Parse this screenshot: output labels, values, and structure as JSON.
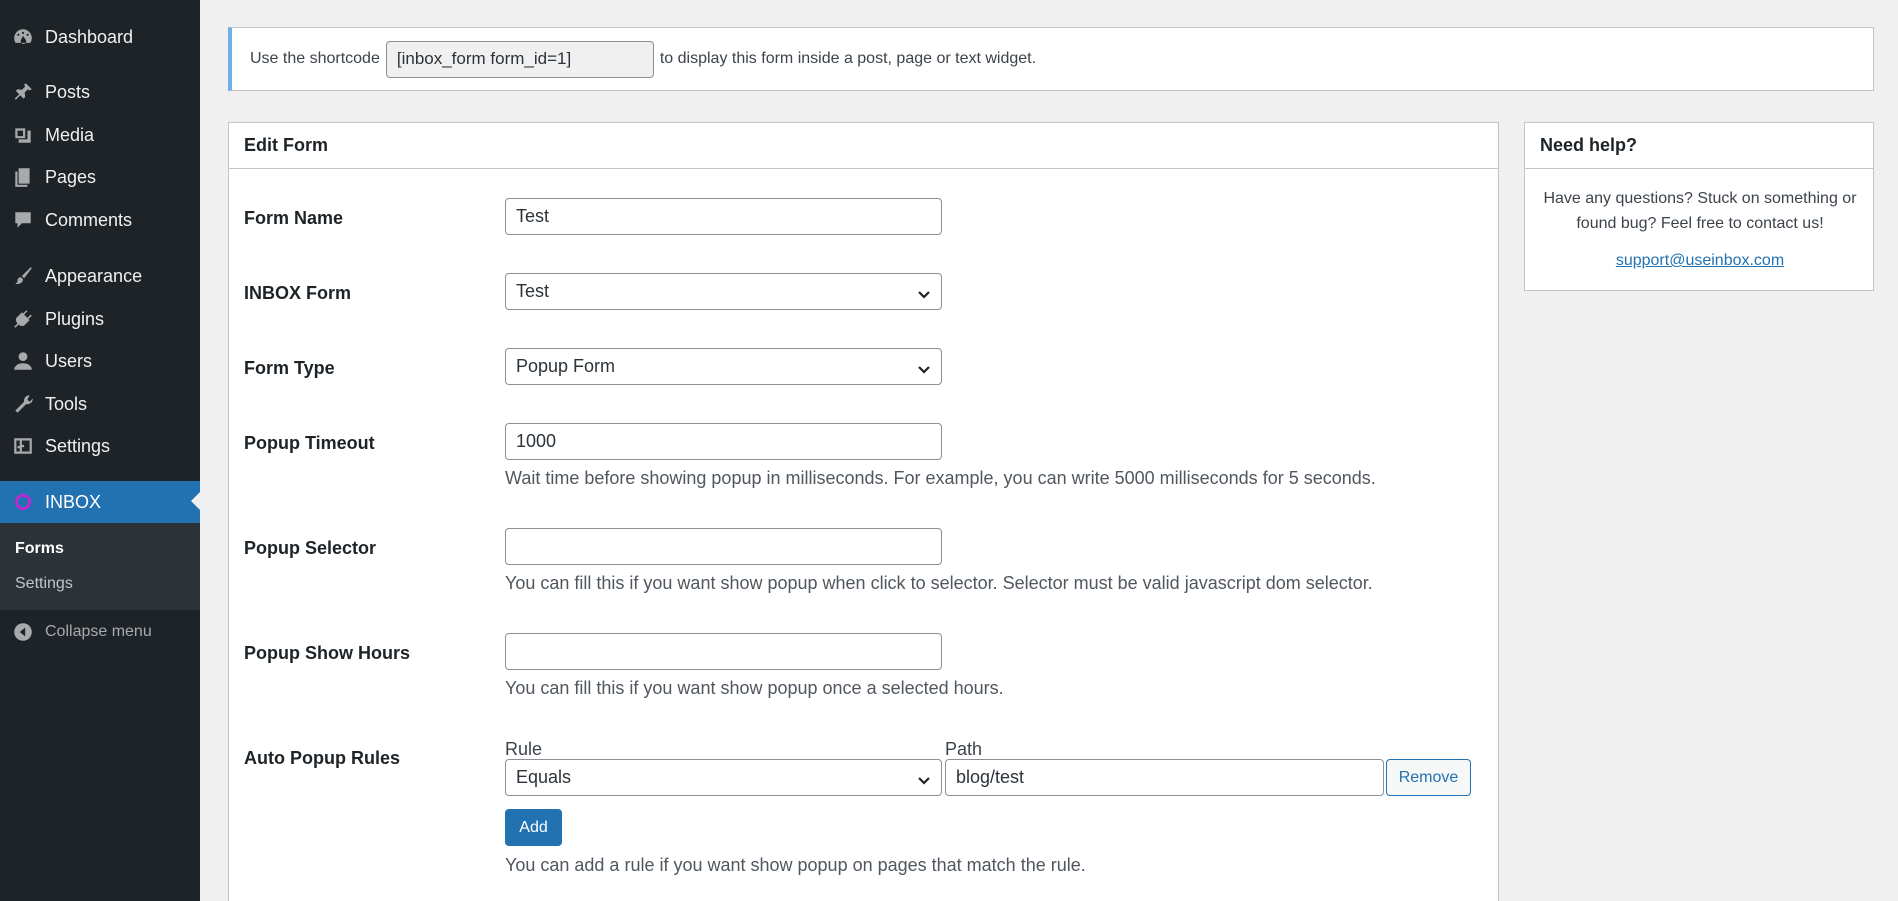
{
  "sidebar": {
    "items": [
      {
        "label": "Dashboard",
        "icon": "dashboard-icon"
      },
      {
        "label": "Posts",
        "icon": "pin-icon"
      },
      {
        "label": "Media",
        "icon": "media-icon"
      },
      {
        "label": "Pages",
        "icon": "pages-icon"
      },
      {
        "label": "Comments",
        "icon": "comment-icon"
      },
      {
        "label": "Appearance",
        "icon": "brush-icon"
      },
      {
        "label": "Plugins",
        "icon": "plugin-icon"
      },
      {
        "label": "Users",
        "icon": "user-icon"
      },
      {
        "label": "Tools",
        "icon": "wrench-icon"
      },
      {
        "label": "Settings",
        "icon": "settings-icon"
      },
      {
        "label": "INBOX",
        "icon": "inbox-logo-icon"
      }
    ],
    "submenu": [
      {
        "label": "Forms"
      },
      {
        "label": "Settings"
      }
    ],
    "collapse_label": "Collapse menu"
  },
  "notice": {
    "text_before": "Use the shortcode",
    "shortcode": "[inbox_form form_id=1]",
    "text_after": "to display this form inside a post, page or text widget."
  },
  "edit_form": {
    "title": "Edit Form",
    "form_name": {
      "label": "Form Name",
      "value": "Test"
    },
    "inbox_form": {
      "label": "INBOX Form",
      "value": "Test"
    },
    "form_type": {
      "label": "Form Type",
      "value": "Popup Form"
    },
    "popup_timeout": {
      "label": "Popup Timeout",
      "value": "1000",
      "description": "Wait time before showing popup in milliseconds. For example, you can write 5000 milliseconds for 5 seconds."
    },
    "popup_selector": {
      "label": "Popup Selector",
      "value": "",
      "description": "You can fill this if you want show popup when click to selector. Selector must be valid javascript dom selector."
    },
    "popup_show_hours": {
      "label": "Popup Show Hours",
      "value": "",
      "description": "You can fill this if you want show popup once a selected hours."
    },
    "auto_popup_rules": {
      "label": "Auto Popup Rules",
      "rule_header": "Rule",
      "path_header": "Path",
      "rule_value": "Equals",
      "path_value": "blog/test",
      "remove_label": "Remove",
      "add_label": "Add",
      "description": "You can add a rule if you want show popup on pages that match the rule."
    }
  },
  "help": {
    "title": "Need help?",
    "text": "Have any questions? Stuck on something or found bug? Feel free to contact us!",
    "email": "support@useinbox.com"
  },
  "colors": {
    "sidebar_bg": "#1d2327",
    "accent": "#2271b1",
    "inbox_logo": "#c026d3",
    "notice_border": "#72aee6"
  }
}
